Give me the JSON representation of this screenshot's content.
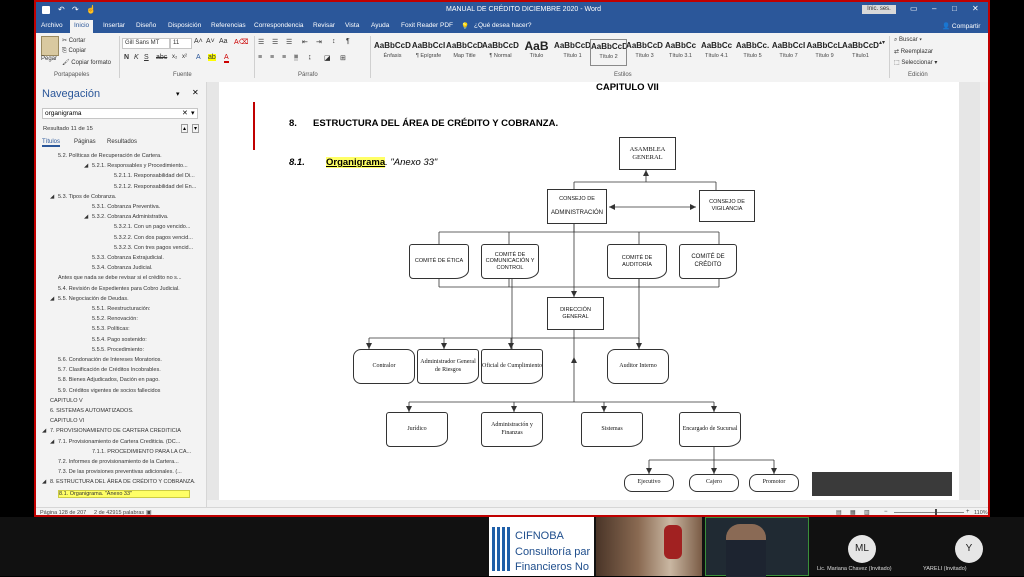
{
  "window": {
    "title": "MANUAL DE CRÉDITO DICIEMBRE 2020  -  Word",
    "signin": "Inic. ses."
  },
  "tabs": [
    "Archivo",
    "Inicio",
    "Insertar",
    "Diseño",
    "Disposición",
    "Referencias",
    "Correspondencia",
    "Revisar",
    "Vista",
    "Ayuda",
    "Foxit Reader PDF",
    "¿Qué desea hacer?"
  ],
  "share_label": "Compartir",
  "ribbon": {
    "clipboard": {
      "paste": "Pegar",
      "cut": "Cortar",
      "copy": "Copiar",
      "format": "Copiar formato",
      "label": "Portapapeles"
    },
    "font": {
      "name": "Gill Sans MT",
      "size": "11",
      "label": "Fuente"
    },
    "paragraph_label": "Párrafo",
    "styles": [
      {
        "sample": "AaBbCcDdi",
        "name": "Énfasis"
      },
      {
        "sample": "AaBbCcI",
        "name": "¶ Epígrafe"
      },
      {
        "sample": "AaBbCcD",
        "name": "Map Title"
      },
      {
        "sample": "AaBbCcDc",
        "name": "¶ Normal"
      },
      {
        "sample": "AaB",
        "name": "Título"
      },
      {
        "sample": "AaBbCcD",
        "name": "Título 1"
      },
      {
        "sample": "AaBbCcD",
        "name": "Título 2"
      },
      {
        "sample": "AaBbCcD",
        "name": "Título 3"
      },
      {
        "sample": "AaBbCc",
        "name": "Título 3.1"
      },
      {
        "sample": "AaBbCc",
        "name": "Título 4.1"
      },
      {
        "sample": "AaBbCc.",
        "name": "Título 5"
      },
      {
        "sample": "AaBbCcI",
        "name": "Título 7"
      },
      {
        "sample": "AaBbCcL",
        "name": "Título 9"
      },
      {
        "sample": "AaBbCcD",
        "name": "Título1"
      }
    ],
    "styles_label": "Estilos",
    "edit": {
      "find": "Buscar",
      "replace": "Reemplazar",
      "select": "Seleccionar",
      "label": "Edición"
    }
  },
  "nav": {
    "title": "Navegación",
    "search_value": "organigrama",
    "result": "Resultado 11 de 15",
    "tabs": [
      "Títulos",
      "Páginas",
      "Resultados"
    ],
    "items": [
      "5.2. Políticas de Recuperación de Cartera.",
      "5.2.1. Responsables y Procedimiento...",
      "5.2.1.1. Responsabilidad del Di...",
      "5.2.1.2. Responsabilidad del En...",
      "5.3. Tipos de Cobranza.",
      "5.3.1. Cobranza Preventiva.",
      "5.3.2. Cobranza Administrativa.",
      "5.3.2.1. Con un pago vencido...",
      "5.3.2.2. Con dos pagos vencid...",
      "5.3.2.3. Con tres pagos vencid...",
      "5.3.3. Cobranza Extrajudicial.",
      "5.3.4. Cobranza Judicial.",
      "Antes que nada se debe revisar si  el crédito no s...",
      "5.4. Revisión de Expedientes para Cobro Judicial.",
      "5.5. Negociación de Deudas.",
      "5.5.1. Reestructuración:",
      "5.5.2. Renovación:",
      "5.5.3. Políticas:",
      "5.5.4. Pago sostenido:",
      "5.5.5. Procedimiento:",
      "5.6. Condonación de Intereses Moratorios.",
      "5.7. Clasificación de Créditos Incobrables.",
      "5.8. Bienes Adjudicados, Dación en pago.",
      "5.9. Créditos vigentes de socios fallecidos",
      "CAPITULO V",
      "6. SISTEMAS AUTOMATIZADOS.",
      "CAPITULO VI",
      "7. PROVISIONAMIENTO DE CARTERA CREDITICIA",
      "7.1. Provisionamiento de Cartera Crediticia. (DC...",
      "7.1.1. PROCEDIMIENTO PARA LA CA...",
      "7.2. Informes de provisionamiento de la Cartera...",
      "7.3. De las provisiones preventivas adicionales. (...",
      "8. ESTRUCTURA DEL ÁREA DE CRÉDITO Y COBRANZA.",
      "8.1. Organigrama. \"Anexo 33\""
    ]
  },
  "document": {
    "chapter": "CAPITULO VII",
    "heading_num": "8.",
    "heading_text": "ESTRUCTURA DEL ÁREA DE CRÉDITO Y COBRANZA.",
    "sub_num": "8.1.",
    "sub_highlight": "Organigrama",
    "sub_rest": ". \"Anexo 33\"",
    "org": {
      "asamblea": "ASAMBLEA GENERAL",
      "consejo_admin_1": "CONSEJO DE",
      "consejo_admin_2": "ADMINISTRACIÓN",
      "consejo_vig": "CONSEJO DE VIGILANCIA",
      "comite_etica": "COMITÉ DE ÉTICA",
      "comite_com": "COMITÉ DE COMUNICACIÓN Y CONTROL",
      "comite_aud": "COMITÉ DE AUDITORÍA",
      "comite_cred": "COMITÉ DE CRÉDITO",
      "direccion": "DIRECCIÓN GENERAL",
      "contralor": "Contralor",
      "admin_riesgos": "Administrador General de Riesgos",
      "oficial": "Oficial de Cumplimiento",
      "auditor": "Auditor Interno",
      "juridico": "Jurídico",
      "admin_fin": "Administración y Finanzas",
      "sistemas": "Sistemas",
      "encargado": "Encargado de Sucursal",
      "ejecutivo": "Ejecutivo",
      "cajero": "Cajero",
      "promotor": "Promotor"
    }
  },
  "status": {
    "page": "Página 128 de 207",
    "words": "2 de 42915 palabras",
    "zoom": "110%"
  },
  "meeting": {
    "presenter_logo_1": "CIFNOBA",
    "presenter_logo_2": "Consultoría par",
    "presenter_logo_3": "Financieros No",
    "p1_initials": "ML",
    "p1_name": "Lic. Mariana Chavez (Invitado)",
    "p2_initials": "Y",
    "p2_name": "YARELI (Invitado)"
  }
}
